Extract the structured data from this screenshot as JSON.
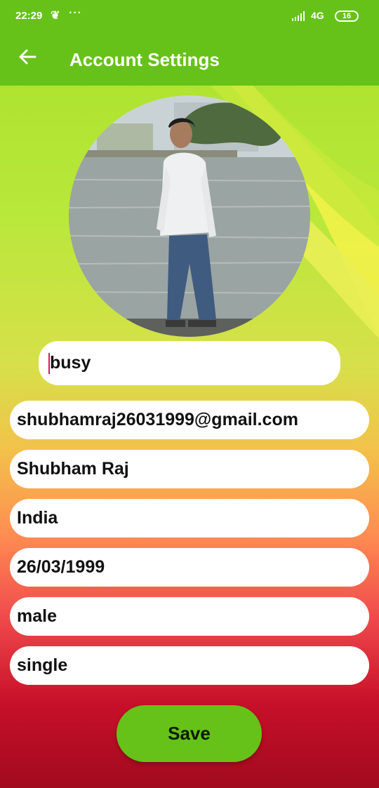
{
  "status_bar": {
    "time": "22:29",
    "app_icon": "squirrel-icon",
    "dots": "···",
    "network": "4G",
    "battery": "16"
  },
  "app_bar": {
    "title": "Account Settings",
    "back_icon": "arrow-left-icon",
    "color": "#66c218"
  },
  "profile": {
    "status": "busy",
    "email": "shubhamraj26031999@gmail.com",
    "name": "Shubham Raj",
    "country": "India",
    "dob": "26/03/1999",
    "gender": "male",
    "relationship": "single"
  },
  "actions": {
    "save_label": "Save"
  }
}
